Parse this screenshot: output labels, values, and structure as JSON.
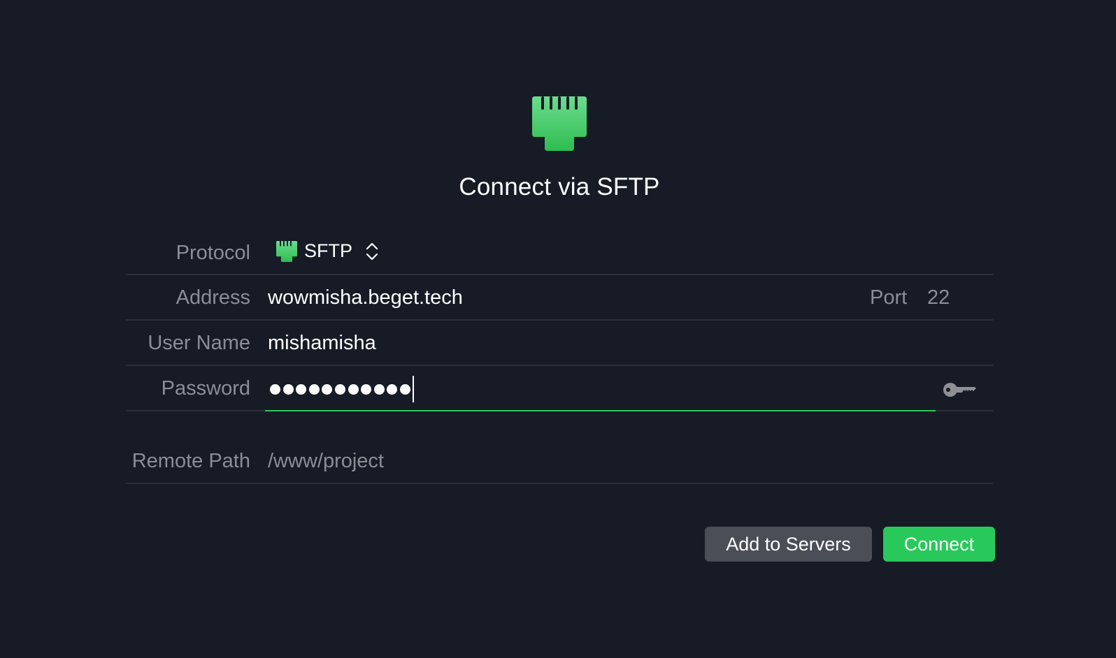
{
  "dialog": {
    "title": "Connect via SFTP",
    "hero_icon": "ethernet-port-icon",
    "accent_color": "#29c85b",
    "background_color": "#161b26"
  },
  "form": {
    "protocol": {
      "label": "Protocol",
      "value": "SFTP",
      "icon": "ethernet-port-icon"
    },
    "address": {
      "label": "Address",
      "value": "wowmisha.beget.tech",
      "port_label": "Port",
      "port_value": "22"
    },
    "username": {
      "label": "User Name",
      "value": "mishamisha"
    },
    "password": {
      "label": "Password",
      "masked_length": 11,
      "icon": "key-icon"
    },
    "remote_path": {
      "label": "Remote Path",
      "placeholder": "/www/project",
      "value": ""
    }
  },
  "buttons": {
    "add_to_servers": "Add to Servers",
    "connect": "Connect"
  }
}
